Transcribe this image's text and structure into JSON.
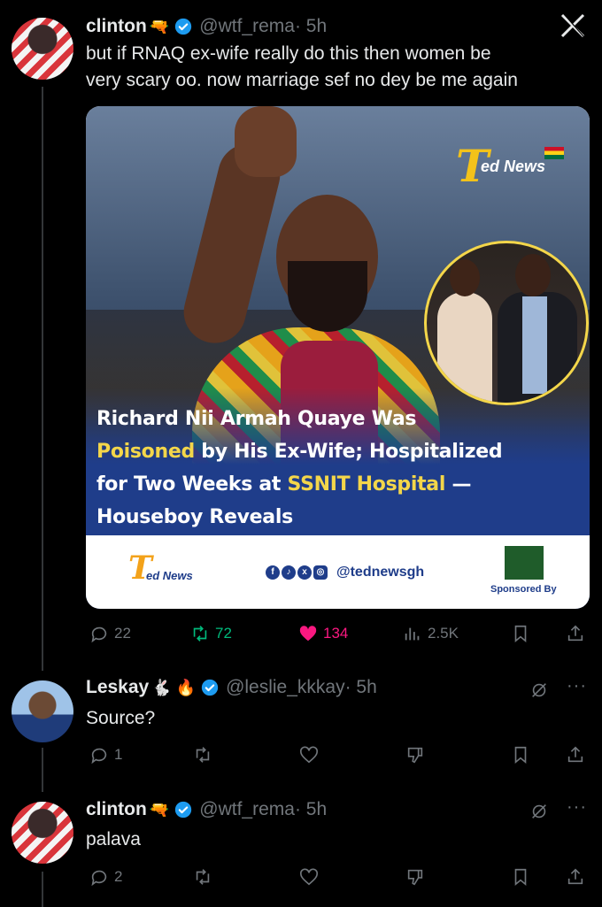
{
  "colors": {
    "background": "#000000",
    "text": "#e7e9ea",
    "muted": "#71767b",
    "retweet": "#00ba7c",
    "like": "#f91880",
    "verified": "#1d9bf0"
  },
  "main_tweet": {
    "name": "clinton",
    "name_emoji": "🔫",
    "handle": "@wtf_rema",
    "time": "· 5h",
    "text_line1": "but if RNAQ ex-wife really do this then women be",
    "text_line2": "very scary oo. now marriage sef no dey be me again",
    "media": {
      "brand": "ed News",
      "headline_part1": "Richard Nii Armah Quaye Was",
      "headline_poisoned": "Poisoned",
      "headline_part2": " by His Ex-Wife; Hospitalized",
      "headline_part3": "for Two Weeks at ",
      "headline_ssnit": "SSNIT Hospital",
      "headline_part4": " —",
      "headline_part5": "Houseboy Reveals",
      "footer_brand": "ed News",
      "footer_handle": "@tednewsgh",
      "sponsored": "Sponsored By"
    },
    "stats": {
      "replies": "22",
      "retweets": "72",
      "likes": "134",
      "views": "2.5K"
    }
  },
  "reply1": {
    "name": "Leskay",
    "name_emoji": "🐇 🔥",
    "handle": "@leslie_kkkay",
    "time": "· 5h",
    "text": "Source?",
    "replies": "1"
  },
  "reply2": {
    "name": "clinton",
    "name_emoji": "🔫",
    "handle": "@wtf_rema",
    "time": "· 5h",
    "text": "palava",
    "replies": "2"
  }
}
